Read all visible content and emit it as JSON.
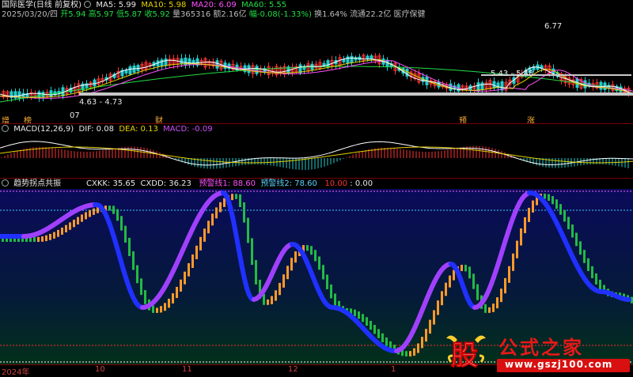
{
  "header": {
    "stock_name": "国际医学(日线 前复权)",
    "ma5_label": "MA5: 5.99",
    "ma10_label": "MA10: 5.98",
    "ma20_label": "MA20: 6.09",
    "ma60_label": "MA60: 5.55",
    "date": "2025/03/20/四",
    "open": "开5.94",
    "high": "高5.97",
    "low": "低5.87",
    "close": "收5.92",
    "volume": "量365316",
    "amount": "额2.16亿",
    "change": "幅-0.08(-1.33%)",
    "turnover": "换1.64%",
    "float_cap": "流通22.2亿",
    "sector": "医疗保健"
  },
  "price_panel": {
    "annot_high": "6.77",
    "annot_range1": "4.63 - 4.73",
    "annot_range2": "5.43 - 5.48",
    "annot_low": "07",
    "tags": [
      "增",
      "榜",
      "财",
      "预",
      "涨"
    ]
  },
  "macd": {
    "title": "MACD(12,26,9)",
    "dif": "DIF: 0.08",
    "dea": "DEA: 0.13",
    "macd": "MACD: -0.09"
  },
  "indicator": {
    "title": "趋势拐点共振",
    "cxkk": "CXKK: 35.65",
    "cxdd": "CXDD: 36.23",
    "warn1": "预警线1: 88.60",
    "warn2": "预警线2: 78.60",
    "v1": "10.00",
    "v2": ": 0.00"
  },
  "xaxis": [
    "2024年",
    "10",
    "11",
    "12",
    "1"
  ],
  "watermark": {
    "big_char": "股",
    "site_name": "公式之家",
    "url": "www.gszj100.com"
  },
  "colors": {
    "up": "#ff3333",
    "down": "#22cccc",
    "ma5": "#ffffff",
    "ma10": "#e6d200",
    "ma20": "#ff50ff",
    "ma60": "#22dd44",
    "purple": "#a040ff",
    "blue": "#2030ff",
    "orange": "#ff9a2a",
    "green": "#22bb44"
  }
}
